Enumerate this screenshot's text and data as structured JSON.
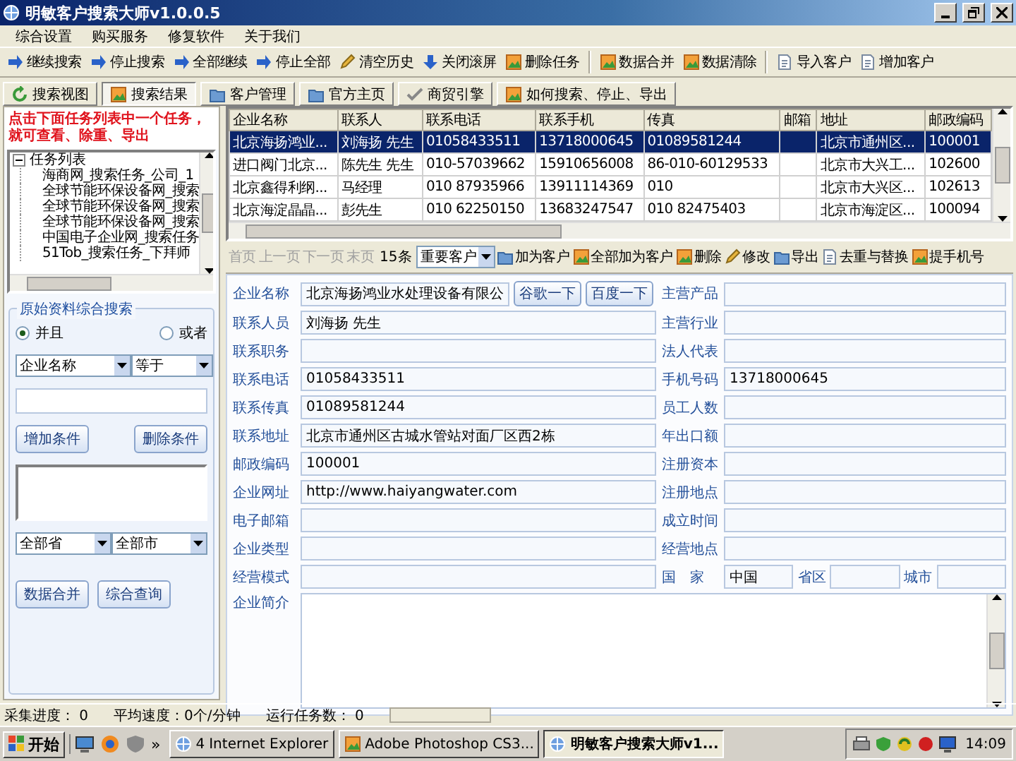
{
  "window": {
    "title": "明敏客户搜索大师v1.0.0.5"
  },
  "menu": [
    "综合设置",
    "购买服务",
    "修复软件",
    "关于我们"
  ],
  "toolbar": [
    [
      "继续搜索",
      "停止搜索",
      "全部继续",
      "停止全部",
      "清空历史",
      "关闭滚屏",
      "删除任务"
    ],
    [
      "数据合并",
      "数据清除"
    ],
    [
      "导入客户",
      "增加客户"
    ]
  ],
  "tabs": [
    {
      "label": "搜索视图",
      "selected": false
    },
    {
      "label": "搜索结果",
      "selected": true
    },
    {
      "label": "客户管理",
      "selected": false
    },
    {
      "label": "官方主页",
      "selected": false
    },
    {
      "label": "商贸引擎",
      "selected": false
    },
    {
      "label": "如何搜索、停止、导出",
      "selected": false
    }
  ],
  "left_panel": {
    "hint": "点击下面任务列表中一个任务，就可查看、除重、导出",
    "tree": {
      "label": "任务列表",
      "expanded": true,
      "children": [
        {
          "label": "海商网_搜索任务_公司_1"
        },
        {
          "label": "全球节能环保设备网_搜索"
        },
        {
          "label": "全球节能环保设备网_搜索"
        },
        {
          "label": "全球节能环保设备网_搜索"
        },
        {
          "label": "中国电子企业网_搜索任务"
        },
        {
          "label": "51Tob_搜索任务_下拜师"
        }
      ]
    },
    "search_group": {
      "title": "原始资料综合搜索",
      "radios": [
        {
          "label": "并且",
          "selected": true
        },
        {
          "label": "或者",
          "selected": false
        }
      ],
      "field_select": "企业名称",
      "operator_select": "等于",
      "buttons": [
        "增加条件",
        "删除条件"
      ],
      "province_select": "全部省",
      "city_select": "全部市",
      "bottom_buttons": [
        "数据合并",
        "综合查询"
      ]
    }
  },
  "results_table": {
    "columns": [
      "企业名称",
      "联系人",
      "联系电话",
      "联系手机",
      "传真",
      "邮箱",
      "地址",
      "邮政编码"
    ],
    "rows": [
      {
        "selected": true,
        "cells": [
          "北京海扬鸿业...",
          "刘海扬 先生",
          "01058433511",
          "13718000645",
          "01089581244",
          null,
          "北京市通州区...",
          "100001"
        ]
      },
      {
        "selected": false,
        "cells": [
          "进口阀门北京...",
          "陈先生 先生",
          "010-57039662",
          "15910656008",
          "86-010-60129533",
          null,
          "北京市大兴工...",
          "102600"
        ]
      },
      {
        "selected": false,
        "cells": [
          "北京鑫得利纲...",
          "马经理",
          "010 87935966",
          "13911114369",
          "010",
          null,
          "北京市大兴区...",
          "102613"
        ]
      },
      {
        "selected": false,
        "cells": [
          "北京海淀晶晶...",
          "彭先生",
          "010 62250150",
          "13683247547",
          "010 82475403",
          null,
          "北京市海淀区...",
          "100094"
        ]
      }
    ]
  },
  "record_toolbar": {
    "pager": [
      {
        "label": "首页",
        "disabled": true
      },
      {
        "label": "上一页",
        "disabled": true
      },
      {
        "label": "下一页",
        "disabled": true
      },
      {
        "label": "末页",
        "disabled": true
      }
    ],
    "count": "15条",
    "category_select": "重要客户",
    "actions": [
      "加为客户",
      "全部加为客户",
      "删除",
      "修改",
      "导出",
      "去重与替换",
      "提手机号"
    ]
  },
  "record_form": {
    "rows": [
      {
        "left": {
          "label": "企业名称",
          "value": "北京海扬鸿业水处理设备有限公",
          "buttons": [
            "谷歌一下",
            "百度一下"
          ]
        },
        "right": [
          {
            "label": "主营产品"
          }
        ]
      },
      {
        "left": {
          "label": "联系人员",
          "value": "刘海扬 先生"
        },
        "right": [
          {
            "label": "主营行业"
          }
        ]
      },
      {
        "left": {
          "label": "联系职务"
        },
        "right": [
          {
            "label": "法人代表"
          }
        ]
      },
      {
        "left": {
          "label": "联系电话",
          "value": "01058433511"
        },
        "right": [
          {
            "label": "手机号码",
            "value": "13718000645"
          }
        ]
      },
      {
        "left": {
          "label": "联系传真",
          "value": "01089581244"
        },
        "right": [
          {
            "label": "员工人数"
          }
        ]
      },
      {
        "left": {
          "label": "联系地址",
          "value": "北京市通州区古城水管站对面厂区西2栋"
        },
        "right": [
          {
            "label": "年出口额"
          }
        ]
      },
      {
        "left": {
          "label": "邮政编码",
          "value": "100001"
        },
        "right": [
          {
            "label": "注册资本"
          }
        ]
      },
      {
        "left": {
          "label": "企业网址",
          "value": "http://www.haiyangwater.com"
        },
        "right": [
          {
            "label": "注册地点"
          }
        ]
      },
      {
        "left": {
          "label": "电子邮箱"
        },
        "right": [
          {
            "label": "成立时间"
          }
        ]
      },
      {
        "left": {
          "label": "企业类型"
        },
        "right": [
          {
            "label": "经营地点"
          }
        ]
      },
      {
        "left": {
          "label": "经营模式"
        },
        "right": [
          {
            "label": "国　家",
            "value": "中国"
          },
          {
            "label": "省区"
          },
          {
            "label": "城市"
          }
        ]
      }
    ],
    "intro_label": "企业简介"
  },
  "status_bar": {
    "items": [
      "采集进度： 0",
      "平均速度：0个/分钟",
      "运行任务数： 0"
    ],
    "progress": {
      "level": 0
    }
  },
  "taskbar": {
    "start": "开始",
    "more": "»",
    "tasks": [
      {
        "label": "Internet Explorer",
        "count": "4",
        "selected": false
      },
      {
        "label": "Adobe Photoshop CS3...",
        "selected": false
      },
      {
        "label": "明敏客户搜索大师v1...",
        "selected": true
      }
    ],
    "clock": "14:09"
  }
}
